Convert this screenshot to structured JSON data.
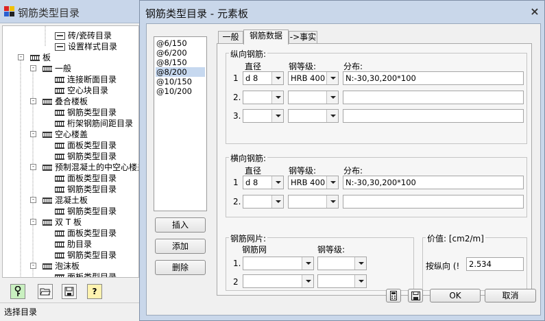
{
  "bg_window": {
    "title": "钢筋类型目录",
    "status": "选择目录",
    "tree": [
      {
        "label": "砖/瓷砖目录",
        "level": 2,
        "icon": "sheet-icon"
      },
      {
        "label": "设置样式目录",
        "level": 2,
        "icon": "sheet-icon"
      },
      {
        "label": "板",
        "level": 0,
        "icon": "book-icon",
        "toggle": "-"
      },
      {
        "label": "一般",
        "level": 1,
        "icon": "book-icon",
        "toggle": "-"
      },
      {
        "label": "连接断面目录",
        "level": 2,
        "icon": "book-icon"
      },
      {
        "label": "空心块目录",
        "level": 2,
        "icon": "book-icon"
      },
      {
        "label": "叠合楼板",
        "level": 1,
        "icon": "book-icon",
        "toggle": "-"
      },
      {
        "label": "钢筋类型目录",
        "level": 2,
        "icon": "book-icon"
      },
      {
        "label": "桁架钢筋间距目录",
        "level": 2,
        "icon": "book-icon"
      },
      {
        "label": "空心楼盖",
        "level": 1,
        "icon": "book-icon",
        "toggle": "-"
      },
      {
        "label": "面板类型目录",
        "level": 2,
        "icon": "book-icon"
      },
      {
        "label": "钢筋类型目录",
        "level": 2,
        "icon": "book-icon"
      },
      {
        "label": "预制混凝土的中空心楼盖",
        "level": 1,
        "icon": "book-icon",
        "toggle": "-"
      },
      {
        "label": "面板类型目录",
        "level": 2,
        "icon": "book-icon"
      },
      {
        "label": "钢筋类型目录",
        "level": 2,
        "icon": "book-icon"
      },
      {
        "label": "混凝土板",
        "level": 1,
        "icon": "book-icon",
        "toggle": "-"
      },
      {
        "label": "钢筋类型目录",
        "level": 2,
        "icon": "book-icon"
      },
      {
        "label": "双 T 板",
        "level": 1,
        "icon": "book-icon",
        "toggle": "-"
      },
      {
        "label": "面板类型目录",
        "level": 2,
        "icon": "book-icon"
      },
      {
        "label": "肋目录",
        "level": 2,
        "icon": "book-icon"
      },
      {
        "label": "钢筋类型目录",
        "level": 2,
        "icon": "book-icon"
      },
      {
        "label": "泡沫板",
        "level": 1,
        "icon": "book-icon",
        "toggle": "-"
      },
      {
        "label": "面板类型目录",
        "level": 2,
        "icon": "book-icon"
      }
    ],
    "toolbar_icons": [
      "key-icon",
      "open-folder-icon",
      "save-icon",
      "help-icon"
    ]
  },
  "dialog": {
    "title": "钢筋类型目录 - 元素板",
    "close": "×",
    "list": [
      "@6/150",
      "@6/200",
      "@8/150",
      "@8/200",
      "@10/150",
      "@10/200"
    ],
    "list_selected": "@8/200",
    "buttons": {
      "insert": "插入",
      "add": "添加",
      "delete": "删除",
      "ok": "OK",
      "cancel": "取消"
    },
    "tabs": [
      "一般",
      "钢筋数据",
      "->事实"
    ],
    "active_tab": "钢筋数据",
    "longitudinal": {
      "title": "纵向钢筋:",
      "col_diameter": "直径",
      "col_grade": "钢等级:",
      "col_dist": "分布:",
      "rows": [
        {
          "n": "1",
          "diameter": "d 8",
          "grade": "HRB 400",
          "dist": "N:-30,30,200*100"
        },
        {
          "n": "2.",
          "diameter": "",
          "grade": "",
          "dist": ""
        },
        {
          "n": "3.",
          "diameter": "",
          "grade": "",
          "dist": ""
        }
      ]
    },
    "transverse": {
      "title": "横向钢筋:",
      "col_diameter": "直径",
      "col_grade": "钢等级:",
      "col_dist": "分布:",
      "rows": [
        {
          "n": "1",
          "diameter": "d 8",
          "grade": "HRB 400",
          "dist": "N:-30,30,200*100"
        },
        {
          "n": "2.",
          "diameter": "",
          "grade": "",
          "dist": ""
        }
      ]
    },
    "mesh": {
      "title": "钢筋网片:",
      "col_mesh": "钢筋网",
      "col_grade": "钢等级:",
      "rows": [
        {
          "n": "1."
        },
        {
          "n": "2"
        }
      ]
    },
    "value": {
      "title": "价值: [cm2/m]",
      "label": "按纵向 (!",
      "input": "2.534"
    }
  }
}
